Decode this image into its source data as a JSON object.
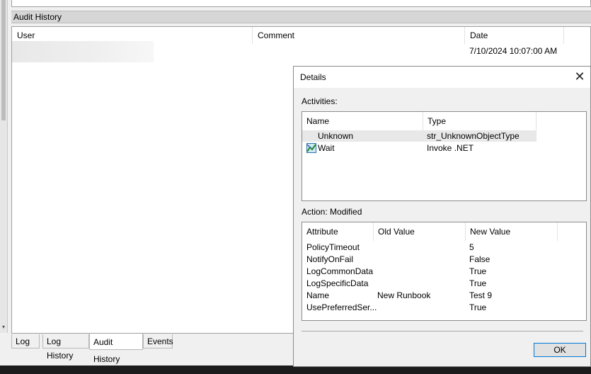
{
  "section_title": "Audit History",
  "audit_grid": {
    "columns": [
      "User",
      "Comment",
      "Date"
    ],
    "rows": [
      {
        "user": "",
        "comment": "",
        "date": "7/10/2024 10:07:00 AM"
      }
    ]
  },
  "bottom_tabs": [
    "Log",
    "Log History",
    "Audit History",
    "Events"
  ],
  "active_tab": "Audit History",
  "dialog": {
    "title": "Details",
    "close_glyph": "✕",
    "activities_label": "Activities:",
    "activities_columns": [
      "Name",
      "Type"
    ],
    "activities": [
      {
        "name": "Unknown",
        "type": "str_UnknownObjectType",
        "icon": ""
      },
      {
        "name": "Wait",
        "type": "Invoke .NET",
        "icon": "runbook-activity-icon"
      }
    ],
    "action_label": "Action: Modified",
    "attr_columns": [
      "Attribute",
      "Old Value",
      "New Value"
    ],
    "attributes": [
      {
        "attribute": "PolicyTimeout",
        "old": "",
        "new": "5"
      },
      {
        "attribute": "NotifyOnFail",
        "old": "",
        "new": "False"
      },
      {
        "attribute": "LogCommonData",
        "old": "",
        "new": "True"
      },
      {
        "attribute": "LogSpecificData",
        "old": "",
        "new": "True"
      },
      {
        "attribute": "Name",
        "old": "New Runbook",
        "new": "Test 9"
      },
      {
        "attribute": "UsePreferredSer...",
        "old": "",
        "new": "True"
      }
    ],
    "ok_label": "OK"
  },
  "colors": {
    "accent": "#0078d7",
    "selection": "#e8e8e8",
    "taskbar": "#1c1c1c"
  }
}
